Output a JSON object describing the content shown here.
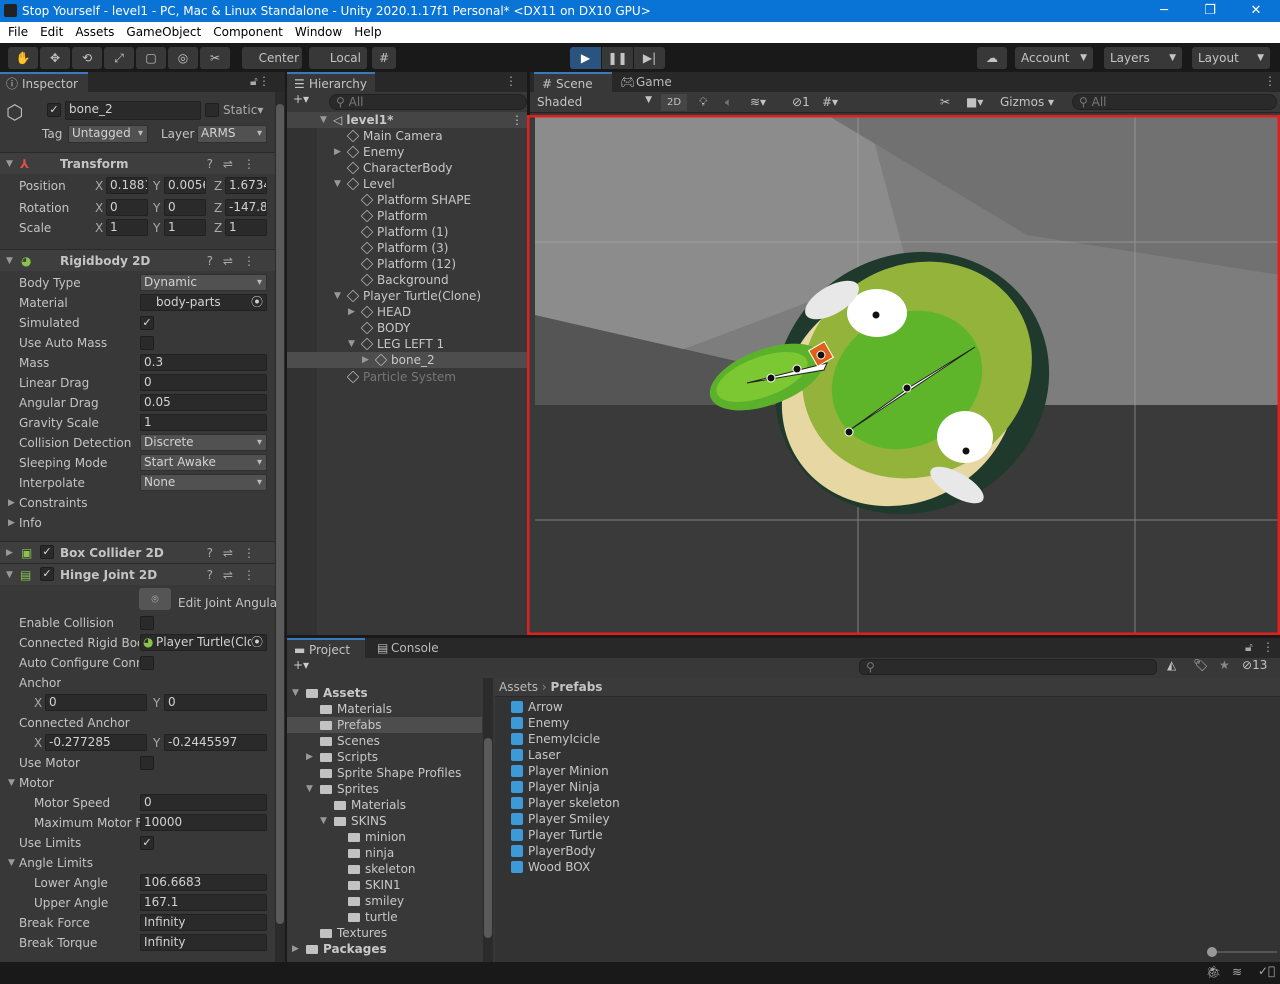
{
  "window": {
    "title": "Stop Yourself - level1 - PC, Mac & Linux Standalone - Unity 2020.1.17f1 Personal* <DX11 on DX10 GPU>",
    "minimize": "─",
    "restore": "❐",
    "close": "✕"
  },
  "menu": [
    "File",
    "Edit",
    "Assets",
    "GameObject",
    "Component",
    "Window",
    "Help"
  ],
  "toolbar": {
    "tools": [
      "hand-tool",
      "move-tool",
      "rotate-tool",
      "scale-tool",
      "rect-tool",
      "transform-tool",
      "custom-tool"
    ],
    "pivot": "Center",
    "space": "Local",
    "play_state": "playing",
    "account": "Account",
    "layers": "Layers",
    "layout": "Layout"
  },
  "inspector": {
    "tab": "Inspector",
    "name": "bone_2",
    "static": "Static",
    "tag_label": "Tag",
    "tag": "Untagged",
    "layer_label": "Layer",
    "layer": "ARMS",
    "transform": {
      "title": "Transform",
      "rows": [
        {
          "label": "Position",
          "x": "0.1881",
          "y": "0.0056",
          "z": "1.6734"
        },
        {
          "label": "Rotation",
          "x": "0",
          "y": "0",
          "z": "-147.8"
        },
        {
          "label": "Scale",
          "x": "1",
          "y": "1",
          "z": "1"
        }
      ]
    },
    "rigidbody": {
      "title": "Rigidbody 2D",
      "body_type_label": "Body Type",
      "body_type": "Dynamic",
      "material_label": "Material",
      "material": "body-parts",
      "simulated_label": "Simulated",
      "simulated": true,
      "auto_mass_label": "Use Auto Mass",
      "auto_mass": false,
      "mass_label": "Mass",
      "mass": "0.3",
      "linear_drag_label": "Linear Drag",
      "linear_drag": "0",
      "angular_drag_label": "Angular Drag",
      "angular_drag": "0.05",
      "gravity_label": "Gravity Scale",
      "gravity": "1",
      "collision_label": "Collision Detection",
      "collision": "Discrete",
      "sleeping_label": "Sleeping Mode",
      "sleeping": "Start Awake",
      "interpolate_label": "Interpolate",
      "interpolate": "None",
      "constraints": "Constraints",
      "info": "Info"
    },
    "box_collider": {
      "title": "Box Collider 2D",
      "enabled": true
    },
    "hinge": {
      "title": "Hinge Joint 2D",
      "enabled": true,
      "edit_label": "Edit Joint Angula",
      "enable_collision_label": "Enable Collision",
      "enable_collision": false,
      "connected_rb_label": "Connected Rigid Bod",
      "connected_rb": "Player Turtle(Clo",
      "auto_conf_label": "Auto Configure Conne",
      "auto_conf": false,
      "anchor_label": "Anchor",
      "anchor_x": "0",
      "anchor_y": "0",
      "conn_anchor_label": "Connected Anchor",
      "conn_anchor_x": "-0.277285",
      "conn_anchor_y": "-0.2445597",
      "use_motor_label": "Use Motor",
      "use_motor": false,
      "motor_label": "Motor",
      "motor_speed_label": "Motor Speed",
      "motor_speed": "0",
      "max_force_label": "Maximum Motor Fc",
      "max_force": "10000",
      "use_limits_label": "Use Limits",
      "use_limits": true,
      "angle_limits_label": "Angle Limits",
      "lower_label": "Lower Angle",
      "lower": "106.6683",
      "upper_label": "Upper Angle",
      "upper": "167.1",
      "break_force_label": "Break Force",
      "break_force": "Infinity",
      "break_torque_label": "Break Torque",
      "break_torque": "Infinity"
    }
  },
  "hierarchy": {
    "tab": "Hierarchy",
    "search_placeholder": "All",
    "items": [
      {
        "label": "level1*",
        "depth": 0,
        "exp": "▼",
        "scene": true
      },
      {
        "label": "Main Camera",
        "depth": 1,
        "exp": ""
      },
      {
        "label": "Enemy",
        "depth": 1,
        "exp": "▶"
      },
      {
        "label": "CharacterBody",
        "depth": 1,
        "exp": ""
      },
      {
        "label": "Level",
        "depth": 1,
        "exp": "▼"
      },
      {
        "label": "Platform SHAPE",
        "depth": 2,
        "exp": ""
      },
      {
        "label": "Platform",
        "depth": 2,
        "exp": ""
      },
      {
        "label": "Platform (1)",
        "depth": 2,
        "exp": ""
      },
      {
        "label": "Platform (3)",
        "depth": 2,
        "exp": ""
      },
      {
        "label": "Platform (12)",
        "depth": 2,
        "exp": ""
      },
      {
        "label": "Background",
        "depth": 2,
        "exp": ""
      },
      {
        "label": "Player Turtle(Clone)",
        "depth": 1,
        "exp": "▼"
      },
      {
        "label": "HEAD",
        "depth": 2,
        "exp": "▶"
      },
      {
        "label": "BODY",
        "depth": 2,
        "exp": ""
      },
      {
        "label": "LEG LEFT 1",
        "depth": 2,
        "exp": "▼"
      },
      {
        "label": "bone_2",
        "depth": 3,
        "exp": "▶",
        "selected": true
      },
      {
        "label": "Particle System",
        "depth": 1,
        "exp": "",
        "disabled": true
      }
    ]
  },
  "scene": {
    "tab": "Scene",
    "game_tab": "Game",
    "shading": "Shaded",
    "mode_2d": "2D",
    "hidden_count": "1",
    "gizmos": "Gizmos",
    "search_placeholder": "All"
  },
  "project": {
    "tab": "Project",
    "console_tab": "Console",
    "hidden_count": "13",
    "breadcrumb": [
      "Assets",
      "Prefabs"
    ],
    "tree": [
      {
        "label": "Assets",
        "depth": 0,
        "exp": "▼",
        "bold": true
      },
      {
        "label": "Materials",
        "depth": 1,
        "exp": ""
      },
      {
        "label": "Prefabs",
        "depth": 1,
        "exp": "",
        "selected": true
      },
      {
        "label": "Scenes",
        "depth": 1,
        "exp": ""
      },
      {
        "label": "Scripts",
        "depth": 1,
        "exp": "▶"
      },
      {
        "label": "Sprite Shape Profiles",
        "depth": 1,
        "exp": ""
      },
      {
        "label": "Sprites",
        "depth": 1,
        "exp": "▼"
      },
      {
        "label": "Materials",
        "depth": 2,
        "exp": ""
      },
      {
        "label": "SKINS",
        "depth": 2,
        "exp": "▼"
      },
      {
        "label": "minion",
        "depth": 3,
        "exp": ""
      },
      {
        "label": "ninja",
        "depth": 3,
        "exp": ""
      },
      {
        "label": "skeleton",
        "depth": 3,
        "exp": ""
      },
      {
        "label": "SKIN1",
        "depth": 3,
        "exp": ""
      },
      {
        "label": "smiley",
        "depth": 3,
        "exp": ""
      },
      {
        "label": "turtle",
        "depth": 3,
        "exp": ""
      },
      {
        "label": "Textures",
        "depth": 1,
        "exp": ""
      },
      {
        "label": "Packages",
        "depth": 0,
        "exp": "▶",
        "bold": true
      }
    ],
    "assets": [
      "Arrow",
      "Enemy",
      "EnemyIcicle",
      "Laser",
      "Player Minion",
      "Player Ninja",
      "Player skeleton",
      "Player Smiley",
      "Player Turtle",
      "PlayerBody",
      "Wood BOX"
    ]
  },
  "colors": {
    "title_bar": "#0a74d6",
    "play_active": "#2a5380",
    "selection_outline": "#e0201f",
    "rigidbody_icon": "#8bc34a",
    "prefab_icon": "#3d9ad9"
  }
}
